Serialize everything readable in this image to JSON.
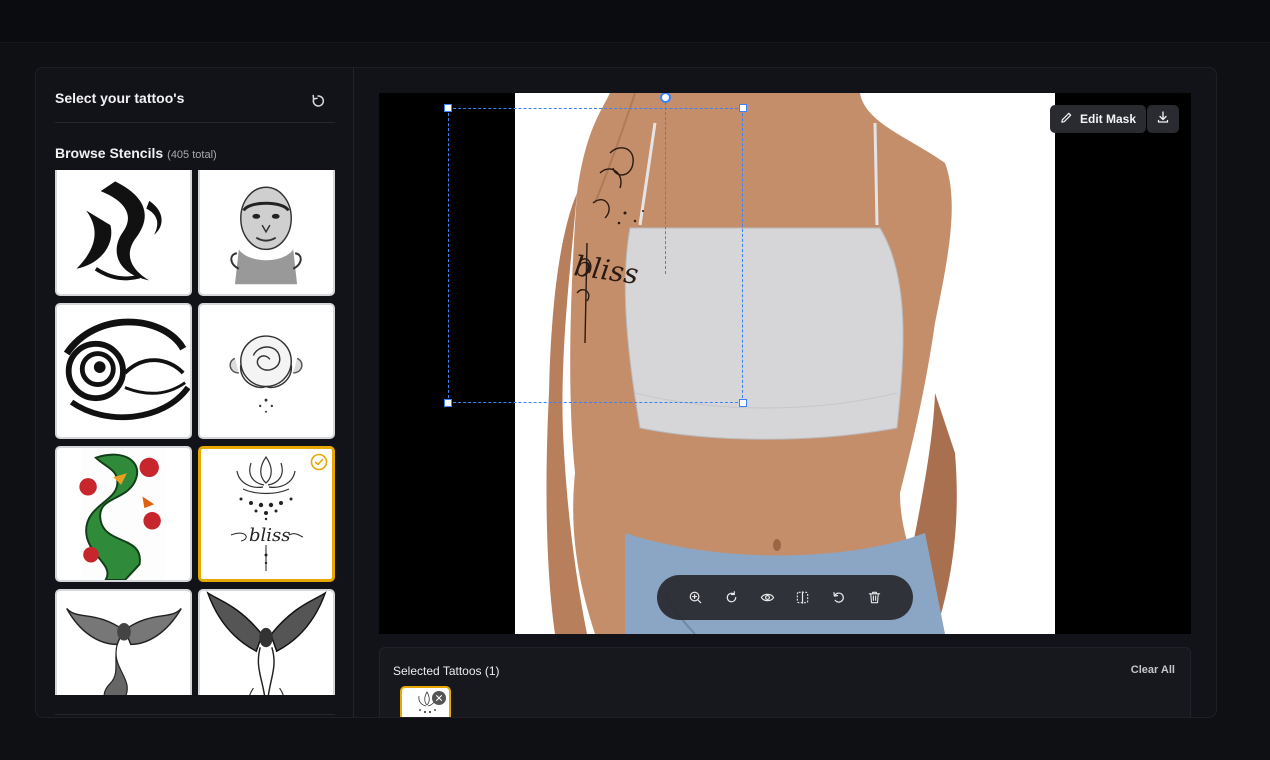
{
  "sidebar": {
    "title": "Select your tattoo's",
    "browse_title": "Browse Stencils",
    "browse_count": "(405 total)"
  },
  "stencils": [
    {
      "name": "tribal"
    },
    {
      "name": "portrait"
    },
    {
      "name": "swirl"
    },
    {
      "name": "rose"
    },
    {
      "name": "dragon"
    },
    {
      "name": "lotus-bliss",
      "selected": true
    },
    {
      "name": "phoenix-1"
    },
    {
      "name": "phoenix-2"
    }
  ],
  "canvas": {
    "edit_mask_label": "Edit Mask",
    "tattoo_text": "bliss"
  },
  "selected_panel": {
    "title": "Selected Tattoos (1)",
    "clear_label": "Clear All"
  },
  "colors": {
    "accent": "#e6a700",
    "selection": "#3b82f6"
  },
  "icons": [
    "reset-icon",
    "check-icon",
    "pencil-icon",
    "download-icon",
    "zoom-in-icon",
    "rotate-icon",
    "eye-icon",
    "flip-icon",
    "undo-icon",
    "trash-icon",
    "close-icon"
  ]
}
